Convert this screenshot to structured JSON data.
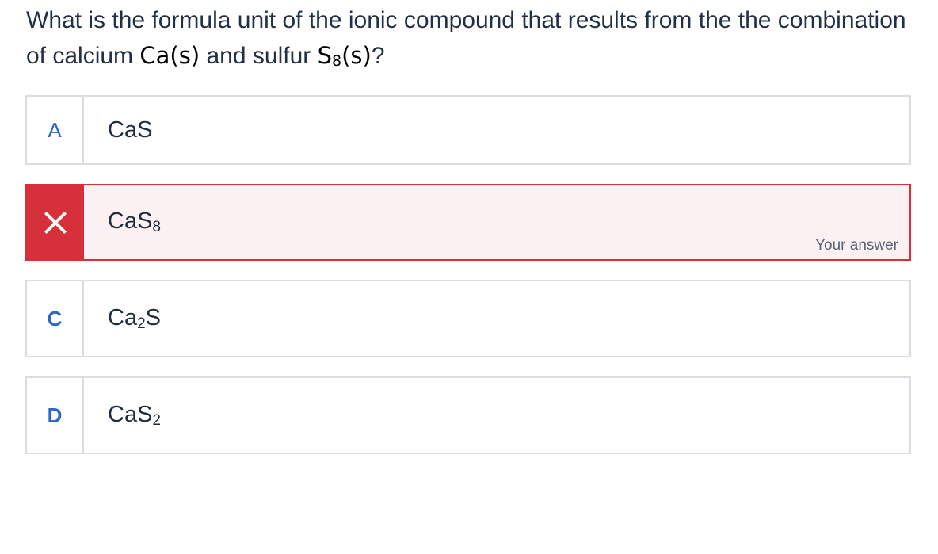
{
  "question": {
    "text_part1": "What is the formula unit of the ionic compound that results from the the combination of calcium ",
    "formula_ca": "Ca(s)",
    "text_part2": " and sulfur ",
    "formula_s8_base": "S",
    "formula_s8_sub": "8",
    "formula_s8_state": "(s)",
    "text_part3": "?"
  },
  "options": [
    {
      "letter": "A",
      "formula_base": "CaS",
      "sub": "",
      "suffix": "",
      "state": "default"
    },
    {
      "letter": "",
      "icon": "close-icon",
      "formula_base": "CaS",
      "sub": "8",
      "suffix": "",
      "state": "incorrect-selected",
      "note": "Your answer"
    },
    {
      "letter": "C",
      "formula_base": "Ca",
      "sub": "2",
      "suffix": "S",
      "state": "default"
    },
    {
      "letter": "D",
      "formula_base": "CaS",
      "sub": "2",
      "suffix": "",
      "state": "default"
    }
  ],
  "colors": {
    "letter_blue": "#2b67c7",
    "incorrect_red": "#d6313a",
    "incorrect_bg": "#fcf1f2",
    "border_gray": "#dadde2"
  }
}
